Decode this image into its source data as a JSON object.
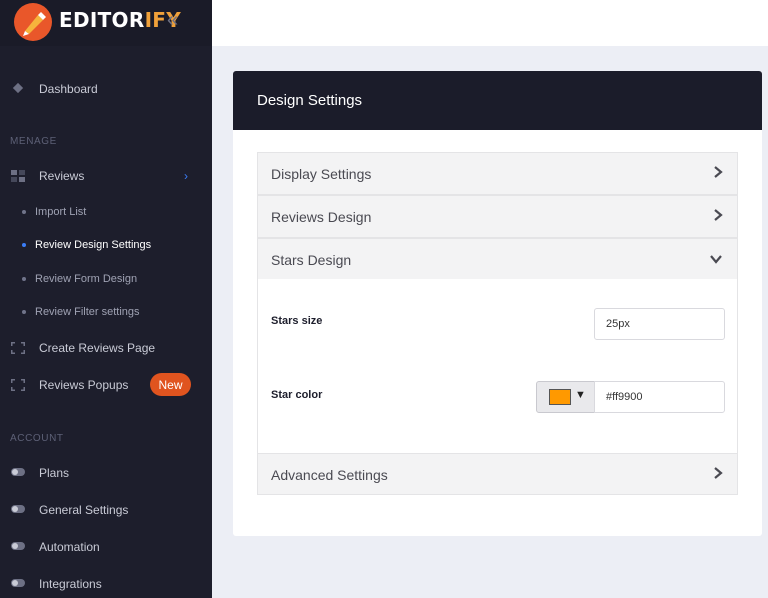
{
  "brand": {
    "name_main": "EDITOR",
    "name_accent": "IFY"
  },
  "sidebar": {
    "dashboard": "Dashboard",
    "section_manage": "MENAGE",
    "reviews": "Reviews",
    "sub_items": [
      "Import List",
      "Review Design Settings",
      "Review Form Design",
      "Review Filter settings"
    ],
    "create_reviews_page": "Create Reviews Page",
    "reviews_popups": "Reviews Popups",
    "new_badge": "New",
    "section_account": "ACCOUNT",
    "plans": "Plans",
    "general_settings": "General Settings",
    "automation": "Automation",
    "integrations": "Integrations"
  },
  "card": {
    "title": "Design Settings",
    "accordions": {
      "display": "Display Settings",
      "reviews_design": "Reviews Design",
      "stars_design": "Stars Design",
      "advanced": "Advanced Settings"
    },
    "stars_size_label": "Stars size",
    "stars_size_value": "25px",
    "star_color_label": "Star color",
    "star_color_value": "#ff9900"
  },
  "colors": {
    "sidebar_bg": "#1d1e2c",
    "accent_blue": "#3b7df8",
    "badge_orange": "#e0541f",
    "star_color": "#ff9900"
  },
  "icons": [
    "logo-icon",
    "collapse-icon",
    "dashboard-icon",
    "grid-icon",
    "chevron-right-icon",
    "chevron-down-icon",
    "page-icon",
    "toggle-icon"
  ]
}
